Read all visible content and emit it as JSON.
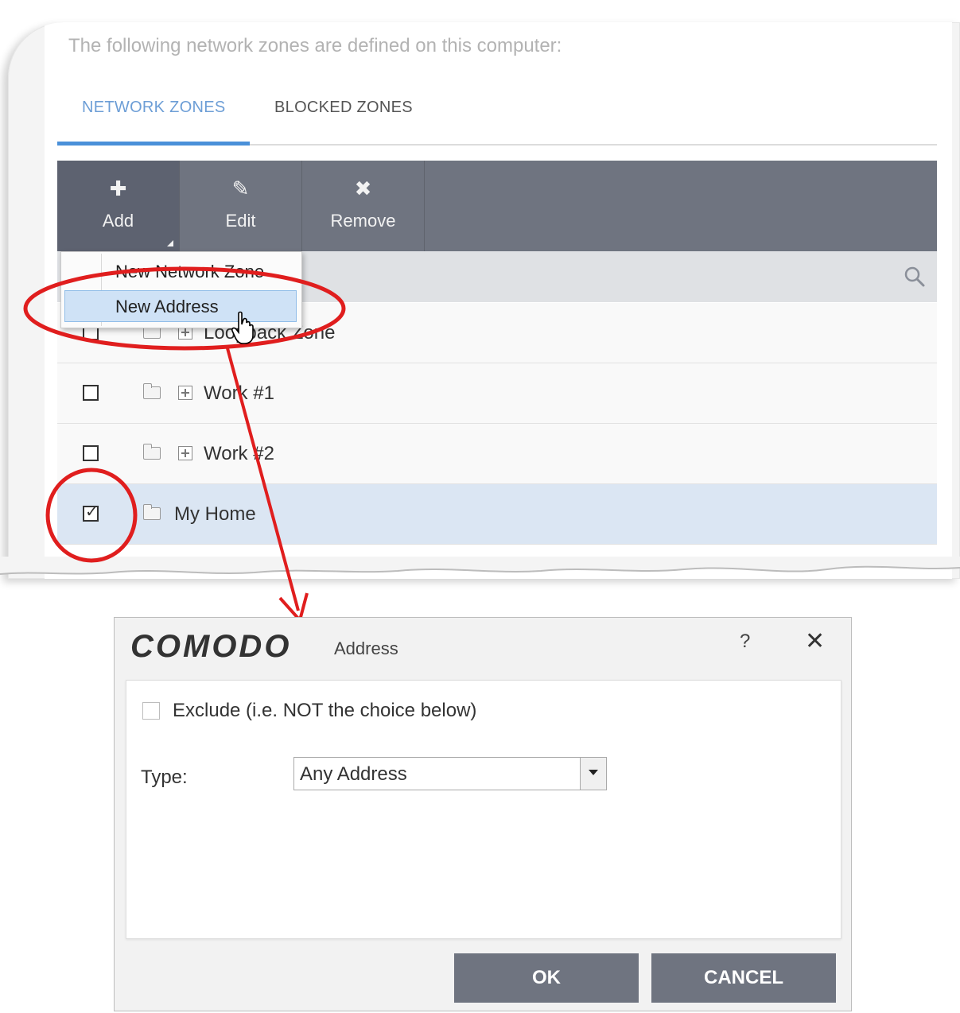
{
  "panel": {
    "heading": "The following network zones are defined on this computer:",
    "tabs": [
      {
        "label": "NETWORK ZONES",
        "active": true
      },
      {
        "label": "BLOCKED ZONES",
        "active": false
      }
    ],
    "toolbar": {
      "add": {
        "label": "Add",
        "icon": "plus-icon"
      },
      "edit": {
        "label": "Edit",
        "icon": "pencil-icon"
      },
      "remove": {
        "label": "Remove",
        "icon": "x-icon"
      }
    },
    "add_menu": {
      "items": [
        "New Network Zone",
        "New Address"
      ],
      "highlighted": "New Address"
    },
    "rows": [
      {
        "label": "Loopback Zone",
        "checked": false,
        "expandable": true
      },
      {
        "label": "Work #1",
        "checked": false,
        "expandable": true
      },
      {
        "label": "Work #2",
        "checked": false,
        "expandable": true
      },
      {
        "label": "My Home",
        "checked": true,
        "expandable": false
      }
    ],
    "colors": {
      "accent": "#4a90d9",
      "toolbar": "#6f7480",
      "annotation": "#e01e1e",
      "selected_row": "#dbe6f3"
    }
  },
  "dialog": {
    "brand": "COMODO",
    "title": "Address",
    "help": "?",
    "close": "✕",
    "exclude_label": "Exclude (i.e. NOT the choice below)",
    "exclude_checked": false,
    "type_label": "Type:",
    "type_value": "Any Address",
    "ok_label": "OK",
    "cancel_label": "CANCEL"
  }
}
